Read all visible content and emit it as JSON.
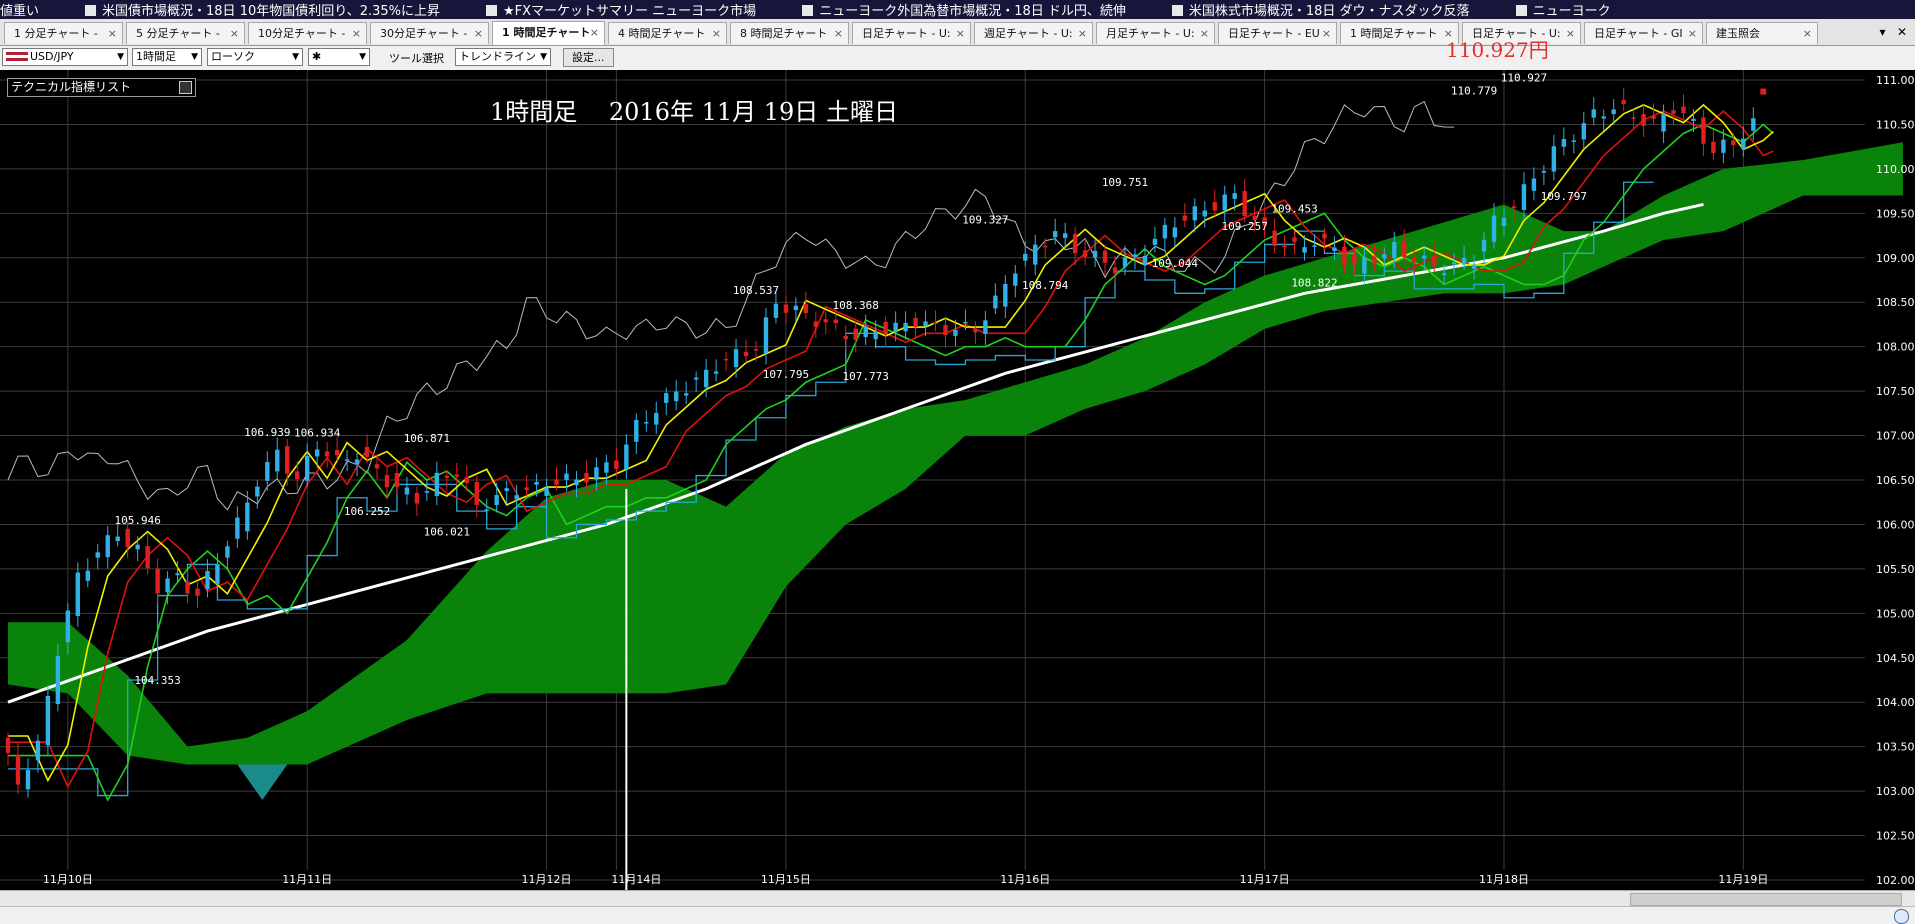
{
  "ticker": {
    "items": [
      "値重い",
      "米国債市場概況・18日 10年物国債利回り、2.35%に上昇",
      "★FXマーケットサマリー ニューヨーク市場",
      "ニューヨーク外国為替市場概況・18日 ドル円、続伸",
      "米国株式市場概況・18日 ダウ・ナスダック反落",
      "ニューヨーク"
    ]
  },
  "tabs": [
    {
      "label": "1 分足チャート -",
      "active": false
    },
    {
      "label": "5 分足チャート -",
      "active": false
    },
    {
      "label": "10分足チャート -",
      "active": false
    },
    {
      "label": "30分足チャート -",
      "active": false
    },
    {
      "label": "1 時間足チャート",
      "active": true
    },
    {
      "label": "4 時間足チャート",
      "active": false
    },
    {
      "label": "8 時間足チャート",
      "active": false
    },
    {
      "label": "日足チャート - U:",
      "active": false
    },
    {
      "label": "週足チャート - U:",
      "active": false
    },
    {
      "label": "月足チャート - U:",
      "active": false
    },
    {
      "label": "日足チャート - EU",
      "active": false
    },
    {
      "label": "1 時間足チャート",
      "active": false
    },
    {
      "label": "日足チャート - U:",
      "active": false
    },
    {
      "label": "日足チャート - GI",
      "active": false
    },
    {
      "label": "建玉照会",
      "active": false
    }
  ],
  "tab_close_glyph": "×",
  "tab_menu_glyph": "▾",
  "tab_window_close_glyph": "✕",
  "toolbar": {
    "pair": "USD/JPY",
    "timeframe": "1時間足",
    "chart_style": "ローソク",
    "line_style": "✱",
    "tool_label": "ツール選択",
    "tool": "トレンドライン",
    "settings_button": "設定..."
  },
  "chart": {
    "technical_list_label": "テクニカル指標リスト",
    "title": "1時間足　 2016年 11月 19日 土曜日",
    "bid_price": "110.927円",
    "colors": {
      "background": "#000000",
      "grid": "#3c3c3c",
      "bull": "#2fb0e8",
      "bear": "#e02020",
      "cloud": "#0a8a0a",
      "cloud_twist": "#1a8a8a",
      "ma_fast": "#f0f000",
      "ma_mid": "#e01010",
      "ma_slow": "#20d020",
      "kijun": "#2aa6d6",
      "chikou": "#bbbbbb",
      "sma_long": "#ffffff",
      "price_label": "#e03030"
    }
  },
  "chart_data": {
    "type": "candlestick",
    "title": "1時間足　 2016年 11月 19日 土曜日",
    "ylim": [
      102.0,
      111.0
    ],
    "y_ticks": [
      "111.00",
      "110.50",
      "110.00",
      "109.50",
      "109.00",
      "108.50",
      "108.00",
      "107.50",
      "107.00",
      "106.50",
      "106.00",
      "105.50",
      "105.00",
      "104.50",
      "104.00",
      "103.50",
      "103.00",
      "102.50",
      "102.00"
    ],
    "x_labels": [
      {
        "label": "11月10日",
        "i": 6
      },
      {
        "label": "11月11日",
        "i": 30
      },
      {
        "label": "11月12日",
        "i": 54
      },
      {
        "label": "11月14日",
        "i": 61
      },
      {
        "label": "11月15日",
        "i": 78
      },
      {
        "label": "11月16日",
        "i": 102
      },
      {
        "label": "11月17日",
        "i": 126
      },
      {
        "label": "11月18日",
        "i": 150
      },
      {
        "label": "11月19日",
        "i": 174
      }
    ],
    "cursor_i": 62,
    "n_bars": 180,
    "price_path": [
      [
        0,
        103.6
      ],
      [
        2,
        103.1
      ],
      [
        4,
        103.5
      ],
      [
        6,
        104.6
      ],
      [
        8,
        105.4
      ],
      [
        10,
        105.7
      ],
      [
        12,
        105.9
      ],
      [
        14,
        105.7
      ],
      [
        16,
        105.3
      ],
      [
        18,
        105.4
      ],
      [
        20,
        105.2
      ],
      [
        22,
        105.6
      ],
      [
        24,
        106.0
      ],
      [
        26,
        106.5
      ],
      [
        28,
        106.8
      ],
      [
        30,
        106.5
      ],
      [
        32,
        106.9
      ],
      [
        34,
        106.7
      ],
      [
        36,
        106.8
      ],
      [
        38,
        106.6
      ],
      [
        40,
        106.4
      ],
      [
        42,
        106.3
      ],
      [
        44,
        106.5
      ],
      [
        46,
        106.6
      ],
      [
        48,
        106.2
      ],
      [
        50,
        106.3
      ],
      [
        52,
        106.4
      ],
      [
        54,
        106.4
      ],
      [
        56,
        106.5
      ],
      [
        58,
        106.5
      ],
      [
        60,
        106.6
      ],
      [
        62,
        106.7
      ],
      [
        64,
        107.1
      ],
      [
        66,
        107.3
      ],
      [
        68,
        107.5
      ],
      [
        70,
        107.6
      ],
      [
        72,
        107.8
      ],
      [
        74,
        107.9
      ],
      [
        76,
        108.0
      ],
      [
        78,
        108.5
      ],
      [
        80,
        108.4
      ],
      [
        82,
        108.3
      ],
      [
        84,
        108.2
      ],
      [
        86,
        108.1
      ],
      [
        88,
        108.2
      ],
      [
        90,
        108.2
      ],
      [
        92,
        108.3
      ],
      [
        94,
        108.2
      ],
      [
        96,
        108.2
      ],
      [
        98,
        108.2
      ],
      [
        100,
        108.5
      ],
      [
        102,
        108.9
      ],
      [
        104,
        109.1
      ],
      [
        106,
        109.3
      ],
      [
        108,
        109.1
      ],
      [
        110,
        109.0
      ],
      [
        112,
        108.9
      ],
      [
        114,
        109.0
      ],
      [
        116,
        109.2
      ],
      [
        118,
        109.4
      ],
      [
        120,
        109.5
      ],
      [
        122,
        109.6
      ],
      [
        124,
        109.7
      ],
      [
        126,
        109.4
      ],
      [
        128,
        109.2
      ],
      [
        130,
        109.1
      ],
      [
        132,
        109.2
      ],
      [
        134,
        109.1
      ],
      [
        136,
        108.9
      ],
      [
        138,
        109.0
      ],
      [
        140,
        109.1
      ],
      [
        142,
        109.0
      ],
      [
        144,
        108.9
      ],
      [
        146,
        108.9
      ],
      [
        148,
        109.0
      ],
      [
        150,
        109.4
      ],
      [
        152,
        109.6
      ],
      [
        154,
        109.9
      ],
      [
        156,
        110.2
      ],
      [
        158,
        110.4
      ],
      [
        160,
        110.6
      ],
      [
        162,
        110.7
      ],
      [
        164,
        110.6
      ],
      [
        166,
        110.5
      ],
      [
        168,
        110.7
      ],
      [
        170,
        110.5
      ],
      [
        172,
        110.2
      ],
      [
        174,
        110.3
      ],
      [
        176,
        110.5
      ],
      [
        178,
        110.7
      ],
      [
        180,
        110.8
      ]
    ],
    "extremes": [
      {
        "label": "105.946",
        "i": 13,
        "value": 105.946,
        "pos": "high"
      },
      {
        "label": "104.353",
        "i": 15,
        "value": 104.353,
        "pos": "low"
      },
      {
        "label": "106.939",
        "i": 26,
        "value": 106.939,
        "pos": "high"
      },
      {
        "label": "106.934",
        "i": 31,
        "value": 106.934,
        "pos": "high"
      },
      {
        "label": "106.252",
        "i": 36,
        "value": 106.252,
        "pos": "low"
      },
      {
        "label": "106.871",
        "i": 42,
        "value": 106.871,
        "pos": "high"
      },
      {
        "label": "106.021",
        "i": 44,
        "value": 106.021,
        "pos": "low"
      },
      {
        "label": "108.537",
        "i": 75,
        "value": 108.537,
        "pos": "high"
      },
      {
        "label": "107.795",
        "i": 78,
        "value": 107.795,
        "pos": "low"
      },
      {
        "label": "108.368",
        "i": 85,
        "value": 108.368,
        "pos": "high"
      },
      {
        "label": "107.773",
        "i": 86,
        "value": 107.773,
        "pos": "low"
      },
      {
        "label": "109.327",
        "i": 98,
        "value": 109.327,
        "pos": "high"
      },
      {
        "label": "108.794",
        "i": 104,
        "value": 108.794,
        "pos": "low"
      },
      {
        "label": "109.751",
        "i": 112,
        "value": 109.751,
        "pos": "high"
      },
      {
        "label": "109.044",
        "i": 117,
        "value": 109.044,
        "pos": "low"
      },
      {
        "label": "109.257",
        "i": 124,
        "value": 109.257,
        "pos": "high"
      },
      {
        "label": "109.453",
        "i": 129,
        "value": 109.453,
        "pos": "high"
      },
      {
        "label": "108.822",
        "i": 131,
        "value": 108.822,
        "pos": "low"
      },
      {
        "label": "110.779",
        "i": 147,
        "value": 110.779,
        "pos": "high"
      },
      {
        "label": "110.927",
        "i": 152,
        "value": 110.927,
        "pos": "high"
      },
      {
        "label": "109.797",
        "i": 156,
        "value": 109.797,
        "pos": "low"
      }
    ],
    "sma_long": [
      [
        0,
        104.0
      ],
      [
        10,
        104.4
      ],
      [
        20,
        104.8
      ],
      [
        30,
        105.1
      ],
      [
        40,
        105.4
      ],
      [
        50,
        105.7
      ],
      [
        60,
        106.0
      ],
      [
        70,
        106.4
      ],
      [
        80,
        106.9
      ],
      [
        90,
        107.3
      ],
      [
        100,
        107.7
      ],
      [
        110,
        108.0
      ],
      [
        120,
        108.3
      ],
      [
        130,
        108.6
      ],
      [
        140,
        108.8
      ],
      [
        150,
        109.0
      ],
      [
        160,
        109.3
      ],
      [
        166,
        109.5
      ],
      [
        170,
        109.6
      ]
    ],
    "cloud": [
      [
        0,
        104.9,
        104.2
      ],
      [
        6,
        104.9,
        104.1
      ],
      [
        12,
        104.3,
        103.4
      ],
      [
        18,
        103.5,
        103.3
      ],
      [
        24,
        103.6,
        103.3
      ],
      [
        30,
        103.9,
        103.3
      ],
      [
        40,
        104.7,
        103.8
      ],
      [
        48,
        105.7,
        104.1
      ],
      [
        54,
        106.3,
        104.1
      ],
      [
        60,
        106.5,
        104.1
      ],
      [
        66,
        106.5,
        104.1
      ],
      [
        72,
        106.2,
        104.2
      ],
      [
        78,
        106.8,
        105.3
      ],
      [
        84,
        107.1,
        106.0
      ],
      [
        90,
        107.3,
        106.4
      ],
      [
        96,
        107.4,
        107.0
      ],
      [
        102,
        107.6,
        107.0
      ],
      [
        108,
        107.8,
        107.3
      ],
      [
        114,
        108.1,
        107.5
      ],
      [
        120,
        108.5,
        107.8
      ],
      [
        126,
        108.8,
        108.2
      ],
      [
        132,
        109.0,
        108.4
      ],
      [
        138,
        109.2,
        108.5
      ],
      [
        144,
        109.4,
        108.6
      ],
      [
        150,
        109.6,
        108.6
      ],
      [
        156,
        109.3,
        108.7
      ],
      [
        160,
        109.3,
        108.9
      ],
      [
        166,
        109.7,
        109.2
      ],
      [
        172,
        110.0,
        109.3
      ],
      [
        180,
        110.1,
        109.7
      ],
      [
        190,
        110.3,
        109.7
      ]
    ],
    "chikou_end_i": 145
  }
}
